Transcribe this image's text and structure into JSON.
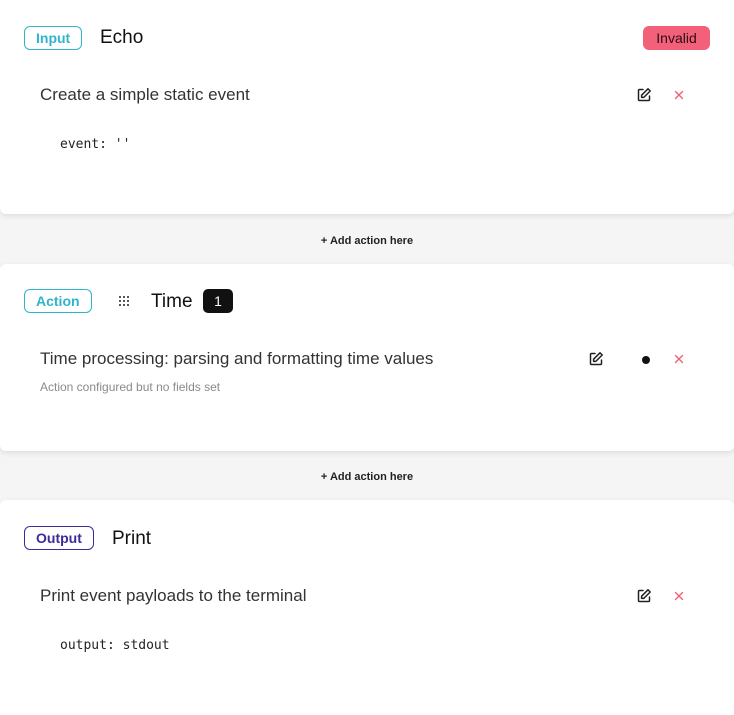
{
  "input": {
    "badge": "Input",
    "title": "Echo",
    "status": "Invalid",
    "description": "Create a simple static event",
    "config": "event: ''",
    "colors": {
      "badge": "#2fb5c9",
      "status": "#f3607a"
    }
  },
  "add_action_1": "+ Add action here",
  "action": {
    "badge": "Action",
    "title": "Time",
    "count": "1",
    "description": "Time processing: parsing and formatting time values",
    "note": "Action configured but no fields set",
    "colors": {
      "badge": "#2fb5c9"
    }
  },
  "add_action_2": "+ Add action here",
  "output": {
    "badge": "Output",
    "title": "Print",
    "description": "Print event payloads to the terminal",
    "config": "output: stdout",
    "colors": {
      "badge": "#3e2a9a"
    }
  },
  "icons": {
    "edit": "edit-icon",
    "delete": "close-icon",
    "drag": "drag-handle-icon"
  }
}
